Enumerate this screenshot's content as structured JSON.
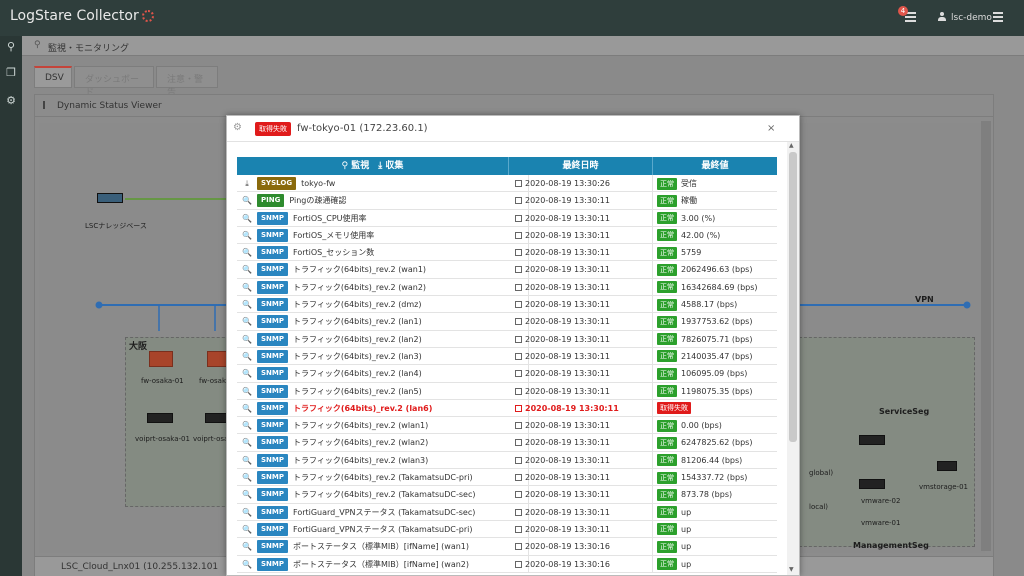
{
  "app": {
    "title": "LogStare Collector",
    "user": "lsc-demo",
    "notif_count": "4"
  },
  "breadcrumb": "監視・モニタリング",
  "tabs": [
    "DSV",
    "ダッシュボード",
    "注意・警告"
  ],
  "panel": {
    "title": "Dynamic Status Viewer"
  },
  "map": {
    "labels": [
      "LSCナレッジベース",
      "VPN",
      "大阪",
      "fw-osaka-01",
      "fw-osaka-",
      "voiprt-osaka-01",
      "voiprt-osaka-",
      "ServiceSeg",
      "global)",
      "vmware-01",
      "vmstorage-01",
      "local)",
      "vmware-02",
      "ManagementSeg"
    ]
  },
  "bottom_panel": "LSC_Cloud_Lnx01 (10.255.132.101",
  "modal": {
    "badge": "取得失敗",
    "title": "fw-tokyo-01 (172.23.60.1)",
    "close": "×",
    "headers": {
      "monitor": "監視",
      "collect": "収集",
      "time": "最終日時",
      "value": "最終値"
    },
    "rows": [
      {
        "icon": "⤓",
        "tag": "SYSLOG",
        "name": "tokyo-fw",
        "time": "2020-08-19  13:30:26",
        "status": "正常",
        "value": "受信"
      },
      {
        "icon": "🔍",
        "tag": "PING",
        "name": "Pingの疎通確認",
        "time": "2020-08-19  13:30:11",
        "status": "正常",
        "value": "稼働"
      },
      {
        "icon": "🔍",
        "tag": "SNMP",
        "name": "FortiOS_CPU使用率",
        "time": "2020-08-19  13:30:11",
        "status": "正常",
        "value": "3.00 (%)"
      },
      {
        "icon": "🔍",
        "tag": "SNMP",
        "name": "FortiOS_メモリ使用率",
        "time": "2020-08-19  13:30:11",
        "status": "正常",
        "value": "42.00 (%)"
      },
      {
        "icon": "🔍",
        "tag": "SNMP",
        "name": "FortiOS_セッション数",
        "time": "2020-08-19  13:30:11",
        "status": "正常",
        "value": "5759"
      },
      {
        "icon": "🔍",
        "tag": "SNMP",
        "name": "トラフィック(64bits)_rev.2 (wan1)",
        "time": "2020-08-19  13:30:11",
        "status": "正常",
        "value": "2062496.63 (bps)"
      },
      {
        "icon": "🔍",
        "tag": "SNMP",
        "name": "トラフィック(64bits)_rev.2 (wan2)",
        "time": "2020-08-19  13:30:11",
        "status": "正常",
        "value": "16342684.69 (bps)"
      },
      {
        "icon": "🔍",
        "tag": "SNMP",
        "name": "トラフィック(64bits)_rev.2 (dmz)",
        "time": "2020-08-19  13:30:11",
        "status": "正常",
        "value": "4588.17 (bps)"
      },
      {
        "icon": "🔍",
        "tag": "SNMP",
        "name": "トラフィック(64bits)_rev.2 (lan1)",
        "time": "2020-08-19  13:30:11",
        "status": "正常",
        "value": "1937753.62 (bps)"
      },
      {
        "icon": "🔍",
        "tag": "SNMP",
        "name": "トラフィック(64bits)_rev.2 (lan2)",
        "time": "2020-08-19  13:30:11",
        "status": "正常",
        "value": "7826075.71 (bps)"
      },
      {
        "icon": "🔍",
        "tag": "SNMP",
        "name": "トラフィック(64bits)_rev.2 (lan3)",
        "time": "2020-08-19  13:30:11",
        "status": "正常",
        "value": "2140035.47 (bps)"
      },
      {
        "icon": "🔍",
        "tag": "SNMP",
        "name": "トラフィック(64bits)_rev.2 (lan4)",
        "time": "2020-08-19  13:30:11",
        "status": "正常",
        "value": "106095.09 (bps)"
      },
      {
        "icon": "🔍",
        "tag": "SNMP",
        "name": "トラフィック(64bits)_rev.2 (lan5)",
        "time": "2020-08-19  13:30:11",
        "status": "正常",
        "value": "1198075.35 (bps)"
      },
      {
        "icon": "🔍",
        "tag": "SNMP",
        "name": "トラフィック(64bits)_rev.2 (lan6)",
        "time": "2020-08-19  13:30:11",
        "status": "取得失敗",
        "value": "",
        "error": true
      },
      {
        "icon": "🔍",
        "tag": "SNMP",
        "name": "トラフィック(64bits)_rev.2 (wlan1)",
        "time": "2020-08-19  13:30:11",
        "status": "正常",
        "value": "0.00 (bps)"
      },
      {
        "icon": "🔍",
        "tag": "SNMP",
        "name": "トラフィック(64bits)_rev.2 (wlan2)",
        "time": "2020-08-19  13:30:11",
        "status": "正常",
        "value": "6247825.62 (bps)"
      },
      {
        "icon": "🔍",
        "tag": "SNMP",
        "name": "トラフィック(64bits)_rev.2 (wlan3)",
        "time": "2020-08-19  13:30:11",
        "status": "正常",
        "value": "81206.44 (bps)"
      },
      {
        "icon": "🔍",
        "tag": "SNMP",
        "name": "トラフィック(64bits)_rev.2 (TakamatsuDC-pri)",
        "time": "2020-08-19  13:30:11",
        "status": "正常",
        "value": "154337.72 (bps)"
      },
      {
        "icon": "🔍",
        "tag": "SNMP",
        "name": "トラフィック(64bits)_rev.2 (TakamatsuDC-sec)",
        "time": "2020-08-19  13:30:11",
        "status": "正常",
        "value": "873.78 (bps)"
      },
      {
        "icon": "🔍",
        "tag": "SNMP",
        "name": "FortiGuard_VPNステータス (TakamatsuDC-sec)",
        "time": "2020-08-19  13:30:11",
        "status": "正常",
        "value": "up"
      },
      {
        "icon": "🔍",
        "tag": "SNMP",
        "name": "FortiGuard_VPNステータス (TakamatsuDC-pri)",
        "time": "2020-08-19  13:30:11",
        "status": "正常",
        "value": "up"
      },
      {
        "icon": "🔍",
        "tag": "SNMP",
        "name": "ポートステータス（標準MIB）[ifName] (wan1)",
        "time": "2020-08-19  13:30:16",
        "status": "正常",
        "value": "up"
      },
      {
        "icon": "🔍",
        "tag": "SNMP",
        "name": "ポートステータス（標準MIB）[ifName] (wan2)",
        "time": "2020-08-19  13:30:16",
        "status": "正常",
        "value": "up"
      }
    ]
  }
}
